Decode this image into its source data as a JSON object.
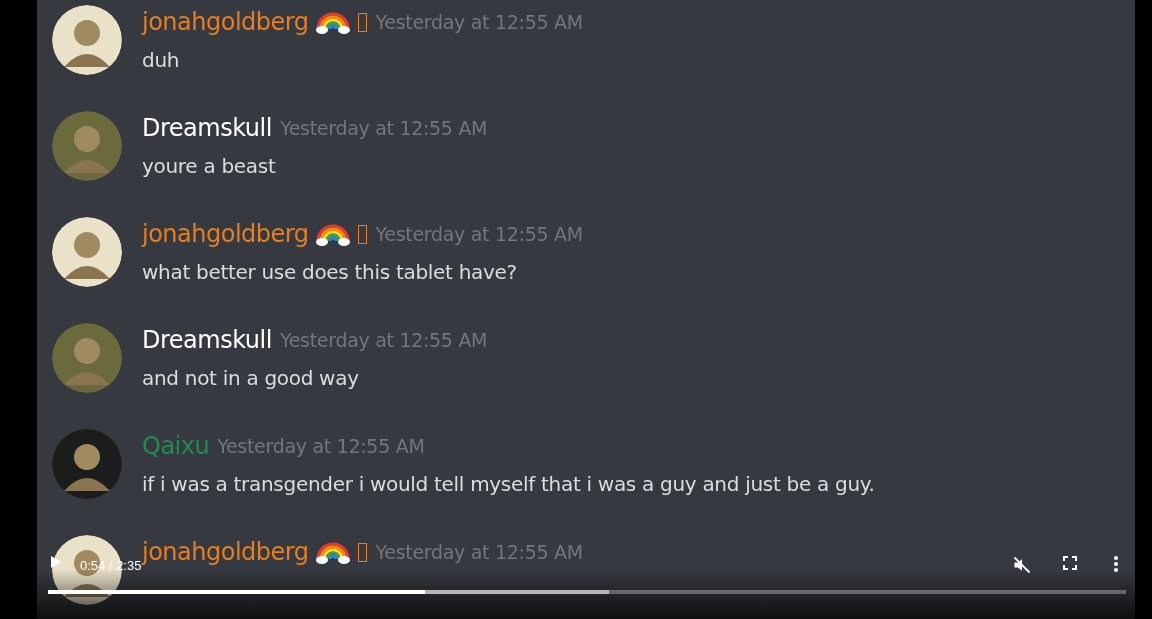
{
  "messages": [
    {
      "author": "jonahgoldberg",
      "color": "#e67e22",
      "emoji_badge": true,
      "time": "Yesterday at 12:55 AM",
      "text": "duh"
    },
    {
      "author": "Dreamskull",
      "color": "#ffffff",
      "emoji_badge": false,
      "time": "Yesterday at 12:55 AM",
      "text": "youre a beast"
    },
    {
      "author": "jonahgoldberg",
      "color": "#e67e22",
      "emoji_badge": true,
      "time": "Yesterday at 12:55 AM",
      "text": "what better use does this tablet have?"
    },
    {
      "author": "Dreamskull",
      "color": "#ffffff",
      "emoji_badge": false,
      "time": "Yesterday at 12:55 AM",
      "text": "and not in a good way"
    },
    {
      "author": "Qaixu",
      "color": "#1f8b4c",
      "emoji_badge": false,
      "time": "Yesterday at 12:55 AM",
      "text": "if i was a transgender i would tell myself that i was a guy and just be a guy."
    },
    {
      "author": "jonahgoldberg",
      "color": "#e67e22",
      "emoji_badge": true,
      "time": "Yesterday at 12:55 AM"
    }
  ],
  "player": {
    "time": "0:54 / 2:35",
    "level": 0.35,
    "muted": true
  }
}
